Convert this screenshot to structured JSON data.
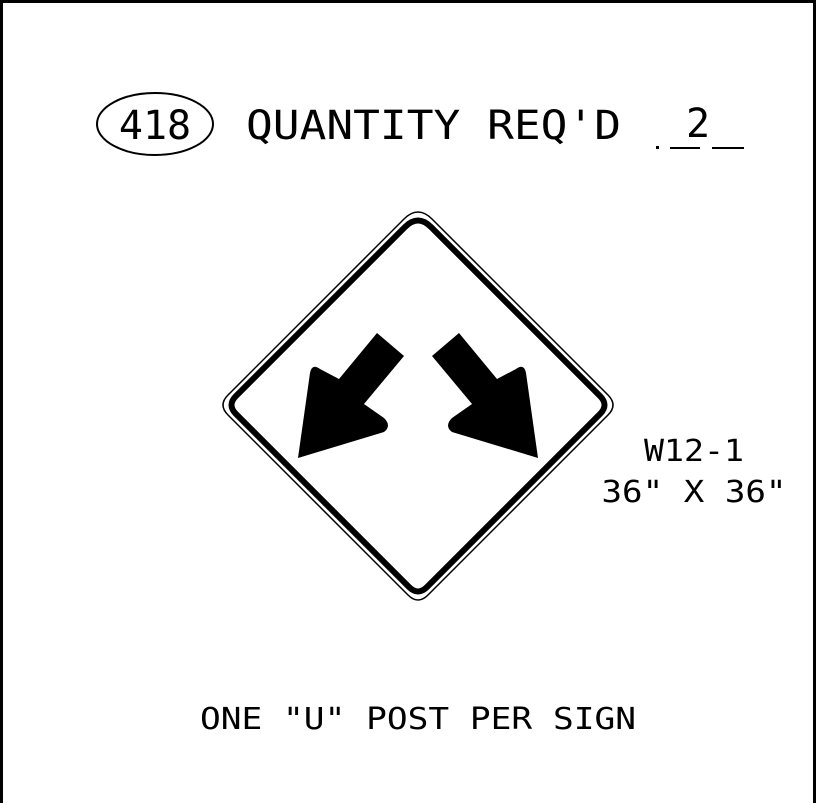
{
  "sign_number": "418",
  "quantity_label": "QUANTITY REQ'D",
  "quantity_value": "2",
  "sign_code": "W12-1",
  "sign_size": "36\" X 36\"",
  "footer_note": "ONE \"U\" POST PER SIGN",
  "sign_graphic": {
    "shape": "diamond",
    "symbol": "divided-highway-double-arrow",
    "icons": [
      "down-left-arrow-icon",
      "down-right-arrow-icon"
    ],
    "background_color": "#ffffff",
    "legend_color": "#000000"
  }
}
